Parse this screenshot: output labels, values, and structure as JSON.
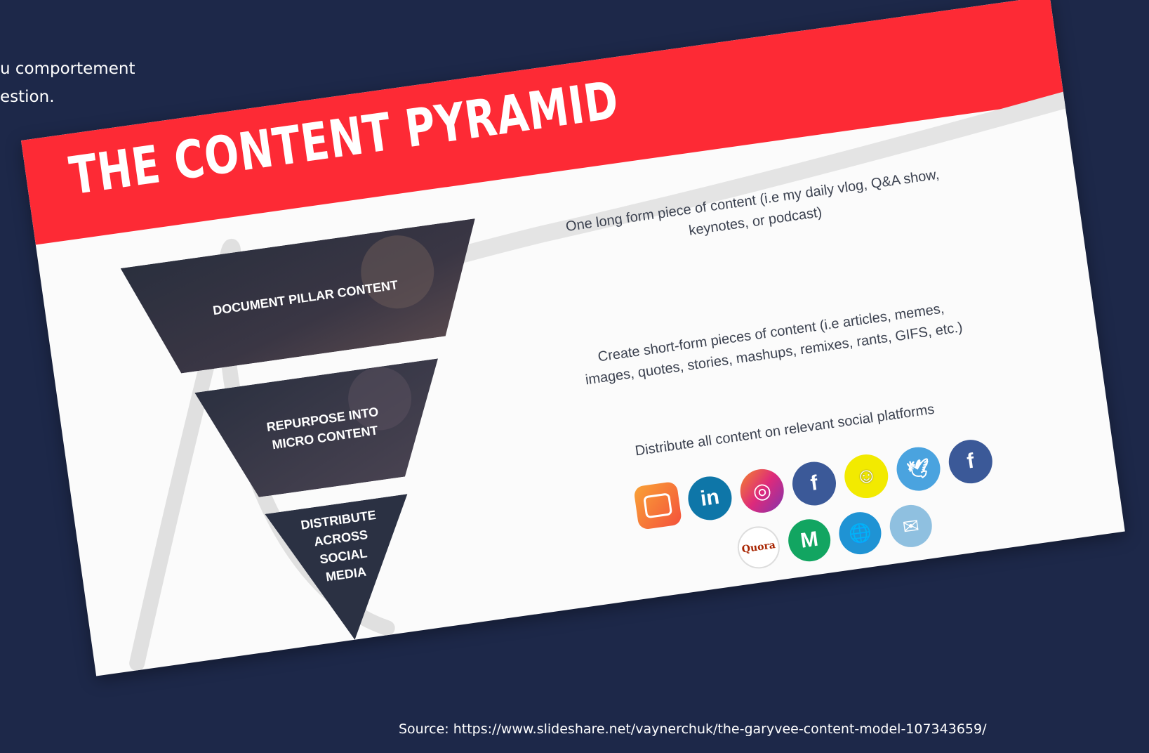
{
  "page": {
    "corner_lines": [
      "u comportement",
      "estion."
    ],
    "source": "Source: https://www.slideshare.net/vaynerchuk/the-garyvee-content-model-107343659/"
  },
  "slide": {
    "title": "THE CONTENT PYRAMID",
    "banner_color": "#fd2a35",
    "tiers": [
      {
        "label": "DOCUMENT PILLAR CONTENT",
        "description": "One long form piece of content (i.e my daily vlog, Q&A show,\nkeynotes, or podcast)"
      },
      {
        "label": "REPURPOSE INTO\nMICRO CONTENT",
        "description": "Create short-form pieces of content (i.e articles, memes,\nimages, quotes, stories, mashups, remixes, rants, GIFS, etc.)"
      },
      {
        "label": "DISTRIBUTE\nACROSS\nSOCIAL\nMEDIA",
        "description": "Distribute all content on relevant social platforms"
      }
    ],
    "icons_row1": [
      {
        "name": "igtv-icon",
        "glyph": "",
        "color": "#f4683a"
      },
      {
        "name": "linkedin-icon",
        "glyph": "in",
        "color": "#0e76a8"
      },
      {
        "name": "instagram-icon",
        "glyph": "◎",
        "color": "#d62a76"
      },
      {
        "name": "facebook-icon",
        "glyph": "f",
        "color": "#3b5998"
      },
      {
        "name": "snapchat-icon",
        "glyph": "☺",
        "color": "#f2ea00"
      },
      {
        "name": "twitter-icon",
        "glyph": "🕊",
        "color": "#4aa3df"
      },
      {
        "name": "facebook-icon",
        "glyph": "f",
        "color": "#3b5998"
      }
    ],
    "icons_row2": [
      {
        "name": "quora-icon",
        "glyph": "Quora",
        "color": "#ffffff"
      },
      {
        "name": "medium-icon",
        "glyph": "M",
        "color": "#12a561"
      },
      {
        "name": "web-icon",
        "glyph": "🌐",
        "color": "#1f93d4"
      },
      {
        "name": "email-icon",
        "glyph": "✉",
        "color": "#8fc0e0"
      }
    ]
  }
}
